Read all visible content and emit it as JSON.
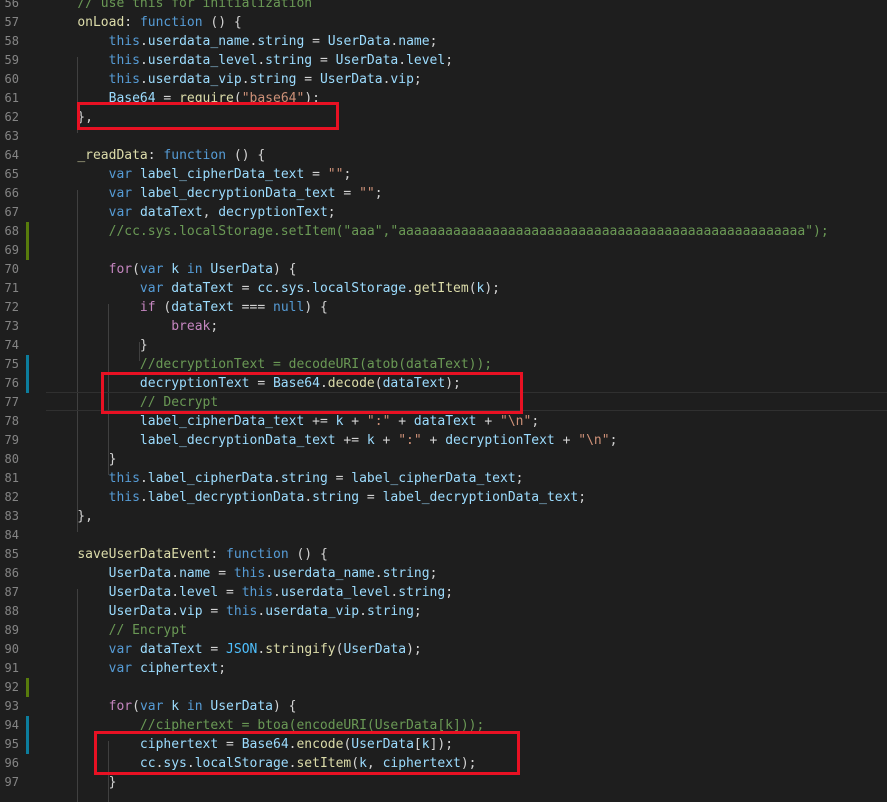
{
  "colors": {
    "background": "#1e1e1e",
    "line_number": "#858585",
    "comment": "#6a9955",
    "keyword": "#569cd6",
    "control": "#c586c0",
    "property": "#9cdcfe",
    "function": "#dcdcaa",
    "string": "#ce9178",
    "plain": "#d4d4d4",
    "annotation_box": "#e81123",
    "gutter_added": "#587c0c",
    "gutter_modified": "#0c7d9d"
  },
  "lines": [
    {
      "n": "56",
      "mark": "",
      "tokens": [
        [
          "    ",
          "plain"
        ],
        [
          "// use this for initialization",
          "comment"
        ]
      ]
    },
    {
      "n": "57",
      "mark": "",
      "tokens": [
        [
          "    ",
          "plain"
        ],
        [
          "onLoad",
          "function"
        ],
        [
          ": ",
          "plain"
        ],
        [
          "function",
          "keyword"
        ],
        [
          " () {",
          "plain"
        ]
      ]
    },
    {
      "n": "58",
      "mark": "",
      "tokens": [
        [
          "        ",
          "plain"
        ],
        [
          "this",
          "keyword"
        ],
        [
          ".",
          "plain"
        ],
        [
          "userdata_name",
          "property"
        ],
        [
          ".",
          "plain"
        ],
        [
          "string",
          "property"
        ],
        [
          " = ",
          "plain"
        ],
        [
          "UserData",
          "property"
        ],
        [
          ".",
          "plain"
        ],
        [
          "name",
          "property"
        ],
        [
          ";",
          "plain"
        ]
      ]
    },
    {
      "n": "59",
      "mark": "",
      "tokens": [
        [
          "        ",
          "plain"
        ],
        [
          "this",
          "keyword"
        ],
        [
          ".",
          "plain"
        ],
        [
          "userdata_level",
          "property"
        ],
        [
          ".",
          "plain"
        ],
        [
          "string",
          "property"
        ],
        [
          " = ",
          "plain"
        ],
        [
          "UserData",
          "property"
        ],
        [
          ".",
          "plain"
        ],
        [
          "level",
          "property"
        ],
        [
          ";",
          "plain"
        ]
      ]
    },
    {
      "n": "60",
      "mark": "",
      "tokens": [
        [
          "        ",
          "plain"
        ],
        [
          "this",
          "keyword"
        ],
        [
          ".",
          "plain"
        ],
        [
          "userdata_vip",
          "property"
        ],
        [
          ".",
          "plain"
        ],
        [
          "string",
          "property"
        ],
        [
          " = ",
          "plain"
        ],
        [
          "UserData",
          "property"
        ],
        [
          ".",
          "plain"
        ],
        [
          "vip",
          "property"
        ],
        [
          ";",
          "plain"
        ]
      ]
    },
    {
      "n": "61",
      "mark": "",
      "tokens": [
        [
          "        ",
          "plain"
        ],
        [
          "Base64",
          "property"
        ],
        [
          " = ",
          "plain"
        ],
        [
          "require",
          "function"
        ],
        [
          "(",
          "plain"
        ],
        [
          "\"base64\"",
          "string"
        ],
        [
          ");",
          "plain"
        ]
      ]
    },
    {
      "n": "62",
      "mark": "",
      "tokens": [
        [
          "    },",
          "plain"
        ]
      ]
    },
    {
      "n": "63",
      "mark": "",
      "tokens": []
    },
    {
      "n": "64",
      "mark": "",
      "tokens": [
        [
          "    ",
          "plain"
        ],
        [
          "_readData",
          "function"
        ],
        [
          ": ",
          "plain"
        ],
        [
          "function",
          "keyword"
        ],
        [
          " () {",
          "plain"
        ]
      ]
    },
    {
      "n": "65",
      "mark": "",
      "tokens": [
        [
          "        ",
          "plain"
        ],
        [
          "var",
          "keyword"
        ],
        [
          " ",
          "plain"
        ],
        [
          "label_cipherData_text",
          "property"
        ],
        [
          " = ",
          "plain"
        ],
        [
          "\"\"",
          "string"
        ],
        [
          ";",
          "plain"
        ]
      ]
    },
    {
      "n": "66",
      "mark": "",
      "tokens": [
        [
          "        ",
          "plain"
        ],
        [
          "var",
          "keyword"
        ],
        [
          " ",
          "plain"
        ],
        [
          "label_decryptionData_text",
          "property"
        ],
        [
          " = ",
          "plain"
        ],
        [
          "\"\"",
          "string"
        ],
        [
          ";",
          "plain"
        ]
      ]
    },
    {
      "n": "67",
      "mark": "",
      "tokens": [
        [
          "        ",
          "plain"
        ],
        [
          "var",
          "keyword"
        ],
        [
          " ",
          "plain"
        ],
        [
          "dataText",
          "property"
        ],
        [
          ", ",
          "plain"
        ],
        [
          "decryptionText",
          "property"
        ],
        [
          ";",
          "plain"
        ]
      ]
    },
    {
      "n": "68",
      "mark": "added",
      "tokens": [
        [
          "        ",
          "plain"
        ],
        [
          "//cc.sys.localStorage.setItem(\"aaa\",\"aaaaaaaaaaaaaaaaaaaaaaaaaaaaaaaaaaaaaaaaaaaaaaaaaaaa\");",
          "comment"
        ]
      ]
    },
    {
      "n": "69",
      "mark": "added",
      "tokens": []
    },
    {
      "n": "70",
      "mark": "",
      "tokens": [
        [
          "        ",
          "plain"
        ],
        [
          "for",
          "control"
        ],
        [
          "(",
          "plain"
        ],
        [
          "var",
          "keyword"
        ],
        [
          " ",
          "plain"
        ],
        [
          "k",
          "property"
        ],
        [
          " ",
          "plain"
        ],
        [
          "in",
          "keyword"
        ],
        [
          " ",
          "plain"
        ],
        [
          "UserData",
          "property"
        ],
        [
          ") {",
          "plain"
        ]
      ]
    },
    {
      "n": "71",
      "mark": "",
      "tokens": [
        [
          "            ",
          "plain"
        ],
        [
          "var",
          "keyword"
        ],
        [
          " ",
          "plain"
        ],
        [
          "dataText",
          "property"
        ],
        [
          " = ",
          "plain"
        ],
        [
          "cc",
          "property"
        ],
        [
          ".",
          "plain"
        ],
        [
          "sys",
          "property"
        ],
        [
          ".",
          "plain"
        ],
        [
          "localStorage",
          "property"
        ],
        [
          ".",
          "plain"
        ],
        [
          "getItem",
          "function"
        ],
        [
          "(",
          "plain"
        ],
        [
          "k",
          "property"
        ],
        [
          ");",
          "plain"
        ]
      ]
    },
    {
      "n": "72",
      "mark": "",
      "tokens": [
        [
          "            ",
          "plain"
        ],
        [
          "if",
          "control"
        ],
        [
          " (",
          "plain"
        ],
        [
          "dataText",
          "property"
        ],
        [
          " === ",
          "plain"
        ],
        [
          "null",
          "keyword"
        ],
        [
          ") {",
          "plain"
        ]
      ]
    },
    {
      "n": "73",
      "mark": "",
      "tokens": [
        [
          "                ",
          "plain"
        ],
        [
          "break",
          "control"
        ],
        [
          ";",
          "plain"
        ]
      ]
    },
    {
      "n": "74",
      "mark": "",
      "tokens": [
        [
          "            }",
          "plain"
        ]
      ]
    },
    {
      "n": "75",
      "mark": "modified",
      "tokens": [
        [
          "            ",
          "plain"
        ],
        [
          "//decryptionText = decodeURI(atob(dataText));",
          "comment"
        ]
      ]
    },
    {
      "n": "76",
      "mark": "modified",
      "tokens": [
        [
          "            ",
          "plain"
        ],
        [
          "decryptionText",
          "property"
        ],
        [
          " = ",
          "plain"
        ],
        [
          "Base64",
          "property"
        ],
        [
          ".",
          "plain"
        ],
        [
          "decode",
          "function"
        ],
        [
          "(",
          "plain"
        ],
        [
          "dataText",
          "property"
        ],
        [
          ");",
          "plain"
        ]
      ]
    },
    {
      "n": "77",
      "mark": "",
      "tokens": [
        [
          "            ",
          "plain"
        ],
        [
          "// Decrypt",
          "comment"
        ]
      ]
    },
    {
      "n": "78",
      "mark": "",
      "tokens": [
        [
          "            ",
          "plain"
        ],
        [
          "label_cipherData_text",
          "property"
        ],
        [
          " += ",
          "plain"
        ],
        [
          "k",
          "property"
        ],
        [
          " + ",
          "plain"
        ],
        [
          "\":\"",
          "string"
        ],
        [
          " + ",
          "plain"
        ],
        [
          "dataText",
          "property"
        ],
        [
          " + ",
          "plain"
        ],
        [
          "\"\\n\"",
          "string"
        ],
        [
          ";",
          "plain"
        ]
      ]
    },
    {
      "n": "79",
      "mark": "",
      "tokens": [
        [
          "            ",
          "plain"
        ],
        [
          "label_decryptionData_text",
          "property"
        ],
        [
          " += ",
          "plain"
        ],
        [
          "k",
          "property"
        ],
        [
          " + ",
          "plain"
        ],
        [
          "\":\"",
          "string"
        ],
        [
          " + ",
          "plain"
        ],
        [
          "decryptionText",
          "property"
        ],
        [
          " + ",
          "plain"
        ],
        [
          "\"\\n\"",
          "string"
        ],
        [
          ";",
          "plain"
        ]
      ]
    },
    {
      "n": "80",
      "mark": "",
      "tokens": [
        [
          "        }",
          "plain"
        ]
      ]
    },
    {
      "n": "81",
      "mark": "",
      "tokens": [
        [
          "        ",
          "plain"
        ],
        [
          "this",
          "keyword"
        ],
        [
          ".",
          "plain"
        ],
        [
          "label_cipherData",
          "property"
        ],
        [
          ".",
          "plain"
        ],
        [
          "string",
          "property"
        ],
        [
          " = ",
          "plain"
        ],
        [
          "label_cipherData_text",
          "property"
        ],
        [
          ";",
          "plain"
        ]
      ]
    },
    {
      "n": "82",
      "mark": "",
      "tokens": [
        [
          "        ",
          "plain"
        ],
        [
          "this",
          "keyword"
        ],
        [
          ".",
          "plain"
        ],
        [
          "label_decryptionData",
          "property"
        ],
        [
          ".",
          "plain"
        ],
        [
          "string",
          "property"
        ],
        [
          " = ",
          "plain"
        ],
        [
          "label_decryptionData_text",
          "property"
        ],
        [
          ";",
          "plain"
        ]
      ]
    },
    {
      "n": "83",
      "mark": "",
      "tokens": [
        [
          "    },",
          "plain"
        ]
      ]
    },
    {
      "n": "84",
      "mark": "",
      "tokens": []
    },
    {
      "n": "85",
      "mark": "",
      "tokens": [
        [
          "    ",
          "plain"
        ],
        [
          "saveUserDataEvent",
          "function"
        ],
        [
          ": ",
          "plain"
        ],
        [
          "function",
          "keyword"
        ],
        [
          " () {",
          "plain"
        ]
      ]
    },
    {
      "n": "86",
      "mark": "",
      "tokens": [
        [
          "        ",
          "plain"
        ],
        [
          "UserData",
          "property"
        ],
        [
          ".",
          "plain"
        ],
        [
          "name",
          "property"
        ],
        [
          " = ",
          "plain"
        ],
        [
          "this",
          "keyword"
        ],
        [
          ".",
          "plain"
        ],
        [
          "userdata_name",
          "property"
        ],
        [
          ".",
          "plain"
        ],
        [
          "string",
          "property"
        ],
        [
          ";",
          "plain"
        ]
      ]
    },
    {
      "n": "87",
      "mark": "",
      "tokens": [
        [
          "        ",
          "plain"
        ],
        [
          "UserData",
          "property"
        ],
        [
          ".",
          "plain"
        ],
        [
          "level",
          "property"
        ],
        [
          " = ",
          "plain"
        ],
        [
          "this",
          "keyword"
        ],
        [
          ".",
          "plain"
        ],
        [
          "userdata_level",
          "property"
        ],
        [
          ".",
          "plain"
        ],
        [
          "string",
          "property"
        ],
        [
          ";",
          "plain"
        ]
      ]
    },
    {
      "n": "88",
      "mark": "",
      "tokens": [
        [
          "        ",
          "plain"
        ],
        [
          "UserData",
          "property"
        ],
        [
          ".",
          "plain"
        ],
        [
          "vip",
          "property"
        ],
        [
          " = ",
          "plain"
        ],
        [
          "this",
          "keyword"
        ],
        [
          ".",
          "plain"
        ],
        [
          "userdata_vip",
          "property"
        ],
        [
          ".",
          "plain"
        ],
        [
          "string",
          "property"
        ],
        [
          ";",
          "plain"
        ]
      ]
    },
    {
      "n": "89",
      "mark": "",
      "tokens": [
        [
          "        ",
          "plain"
        ],
        [
          "// Encrypt",
          "comment"
        ]
      ]
    },
    {
      "n": "90",
      "mark": "",
      "tokens": [
        [
          "        ",
          "plain"
        ],
        [
          "var",
          "keyword"
        ],
        [
          " ",
          "plain"
        ],
        [
          "dataText",
          "property"
        ],
        [
          " = ",
          "plain"
        ],
        [
          "JSON",
          "constant"
        ],
        [
          ".",
          "plain"
        ],
        [
          "stringify",
          "function"
        ],
        [
          "(",
          "plain"
        ],
        [
          "UserData",
          "property"
        ],
        [
          ");",
          "plain"
        ]
      ]
    },
    {
      "n": "91",
      "mark": "",
      "tokens": [
        [
          "        ",
          "plain"
        ],
        [
          "var",
          "keyword"
        ],
        [
          " ",
          "plain"
        ],
        [
          "ciphertext",
          "property"
        ],
        [
          ";",
          "plain"
        ]
      ]
    },
    {
      "n": "92",
      "mark": "added",
      "tokens": []
    },
    {
      "n": "93",
      "mark": "",
      "tokens": [
        [
          "        ",
          "plain"
        ],
        [
          "for",
          "control"
        ],
        [
          "(",
          "plain"
        ],
        [
          "var",
          "keyword"
        ],
        [
          " ",
          "plain"
        ],
        [
          "k",
          "property"
        ],
        [
          " ",
          "plain"
        ],
        [
          "in",
          "keyword"
        ],
        [
          " ",
          "plain"
        ],
        [
          "UserData",
          "property"
        ],
        [
          ") {",
          "plain"
        ]
      ]
    },
    {
      "n": "94",
      "mark": "modified",
      "tokens": [
        [
          "            ",
          "plain"
        ],
        [
          "//ciphertext = btoa(encodeURI(UserData[k]));",
          "comment"
        ]
      ]
    },
    {
      "n": "95",
      "mark": "modified",
      "tokens": [
        [
          "            ",
          "plain"
        ],
        [
          "ciphertext",
          "property"
        ],
        [
          " = ",
          "plain"
        ],
        [
          "Base64",
          "property"
        ],
        [
          ".",
          "plain"
        ],
        [
          "encode",
          "function"
        ],
        [
          "(",
          "plain"
        ],
        [
          "UserData",
          "property"
        ],
        [
          "[",
          "plain"
        ],
        [
          "k",
          "property"
        ],
        [
          "]);",
          "plain"
        ]
      ]
    },
    {
      "n": "96",
      "mark": "",
      "tokens": [
        [
          "            ",
          "plain"
        ],
        [
          "cc",
          "property"
        ],
        [
          ".",
          "plain"
        ],
        [
          "sys",
          "property"
        ],
        [
          ".",
          "plain"
        ],
        [
          "localStorage",
          "property"
        ],
        [
          ".",
          "plain"
        ],
        [
          "setItem",
          "function"
        ],
        [
          "(",
          "plain"
        ],
        [
          "k",
          "property"
        ],
        [
          ", ",
          "plain"
        ],
        [
          "ciphertext",
          "property"
        ],
        [
          ");",
          "plain"
        ]
      ]
    },
    {
      "n": "97",
      "mark": "",
      "tokens": [
        [
          "        }",
          "plain"
        ]
      ]
    }
  ]
}
